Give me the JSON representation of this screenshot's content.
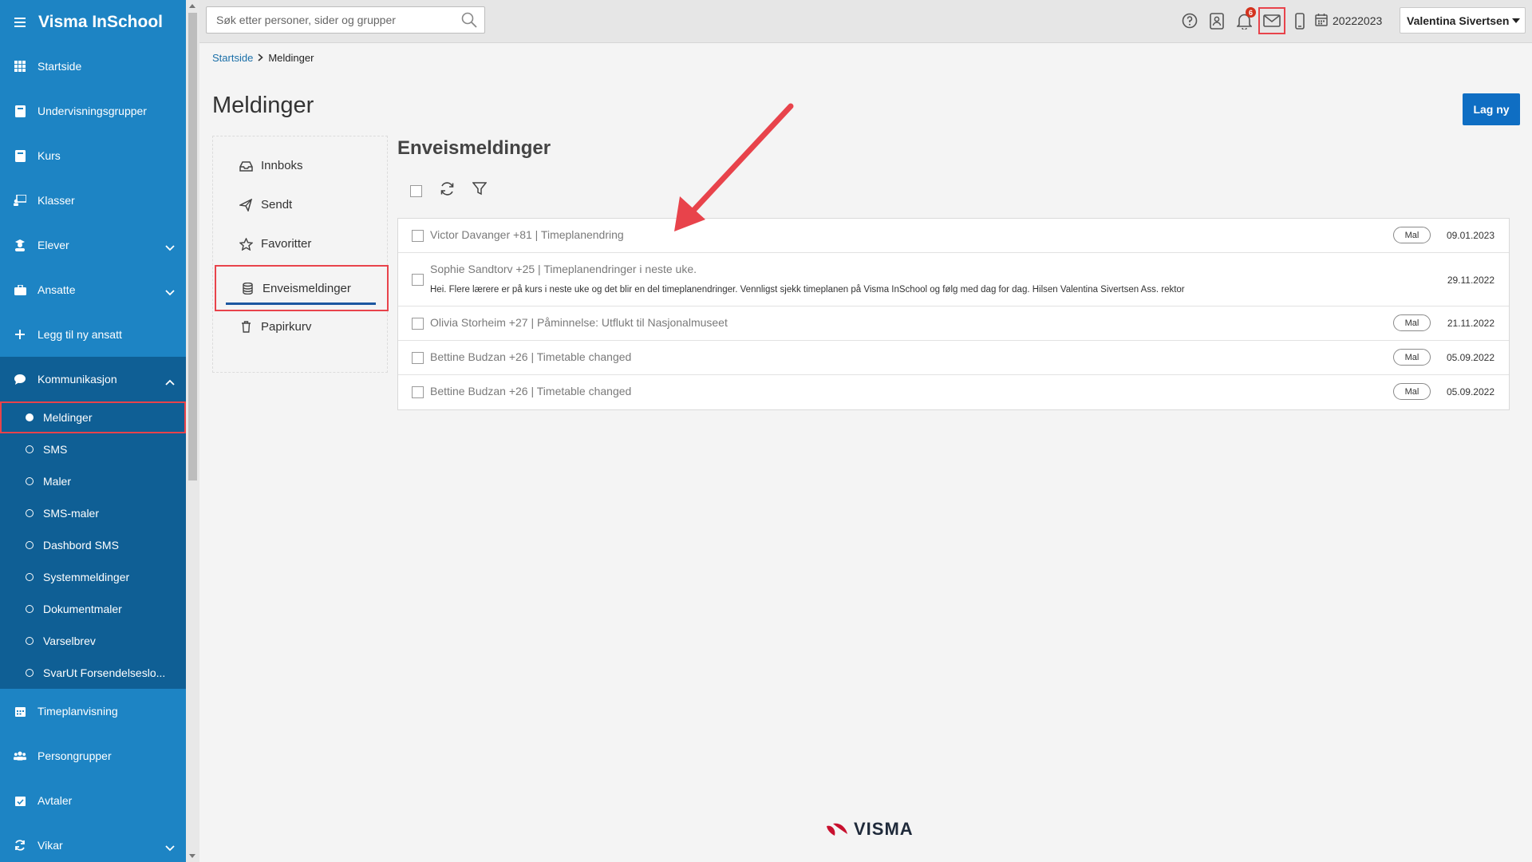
{
  "app": {
    "title": "Visma InSchool"
  },
  "sidebar": {
    "items": [
      {
        "label": "Startside",
        "icon": "grid-icon"
      },
      {
        "label": "Undervisningsgrupper",
        "icon": "book-icon"
      },
      {
        "label": "Kurs",
        "icon": "book-icon"
      },
      {
        "label": "Klasser",
        "icon": "teacher-icon"
      },
      {
        "label": "Elever",
        "icon": "student-icon",
        "expandable": true
      },
      {
        "label": "Ansatte",
        "icon": "briefcase-icon",
        "expandable": true
      },
      {
        "label": "Legg til ny ansatt",
        "icon": "plus-icon"
      }
    ],
    "communication": {
      "label": "Kommunikasjon",
      "icon": "chat-icon",
      "sub_items": [
        {
          "label": "Meldinger",
          "active": true
        },
        {
          "label": "SMS"
        },
        {
          "label": "Maler"
        },
        {
          "label": "SMS-maler"
        },
        {
          "label": "Dashbord SMS"
        },
        {
          "label": "Systemmeldinger"
        },
        {
          "label": "Dokumentmaler"
        },
        {
          "label": "Varselbrev"
        },
        {
          "label": "SvarUt Forsendelseslo..."
        }
      ]
    },
    "bottom_items": [
      {
        "label": "Timeplanvisning",
        "icon": "calendar-icon"
      },
      {
        "label": "Persongrupper",
        "icon": "people-icon"
      },
      {
        "label": "Avtaler",
        "icon": "calendar-check-icon"
      },
      {
        "label": "Vikar",
        "icon": "refresh-icon",
        "expandable": true
      }
    ]
  },
  "topbar": {
    "search_placeholder": "Søk etter personer, sider og grupper",
    "notification_count": "6",
    "school_year": "20222023",
    "user_name": "Valentina Sivertsen"
  },
  "breadcrumb": {
    "home": "Startside",
    "current": "Meldinger"
  },
  "page": {
    "title": "Meldinger",
    "new_button": "Lag ny"
  },
  "folders": [
    {
      "label": "Innboks",
      "icon": "inbox-icon"
    },
    {
      "label": "Sendt",
      "icon": "send-icon"
    },
    {
      "label": "Favoritter",
      "icon": "star-icon"
    },
    {
      "label": "Enveismeldinger",
      "icon": "database-icon",
      "active": true
    },
    {
      "label": "Papirkurv",
      "icon": "trash-icon"
    }
  ],
  "list": {
    "title": "Enveismeldinger",
    "messages": [
      {
        "header": "Victor Davanger +81  |  Timeplanendring",
        "body": "",
        "tag": "Mal",
        "date": "09.01.2023"
      },
      {
        "header": "Sophie Sandtorv +25  |  Timeplanendringer i neste uke.",
        "body": "Hei. Flere lærere er på kurs i neste uke og det blir en del timeplanendringer. Vennligst sjekk timeplanen på Visma InSchool og følg med dag for dag. Hilsen Valentina Sivertsen Ass. rektor",
        "tag": "",
        "date": "29.11.2022"
      },
      {
        "header": "Olivia Storheim +27  |  Påminnelse: Utflukt til Nasjonalmuseet",
        "body": "",
        "tag": "Mal",
        "date": "21.11.2022"
      },
      {
        "header": "Bettine Budzan +26  |  Timetable changed",
        "body": "",
        "tag": "Mal",
        "date": "05.09.2022"
      },
      {
        "header": "Bettine Budzan +26  |  Timetable changed",
        "body": "",
        "tag": "Mal",
        "date": "05.09.2022"
      }
    ]
  },
  "footer": {
    "logo_text": "VISMA"
  },
  "colors": {
    "sidebar": "#1d84c4",
    "sidebar_active": "#0f5f95",
    "accent": "#0f6ec3",
    "highlight": "#e8434b",
    "arrow": "#e8434b"
  }
}
